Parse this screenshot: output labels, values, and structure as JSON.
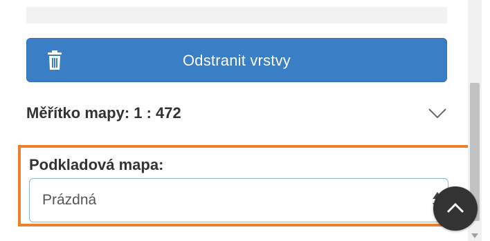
{
  "panel": {
    "delete_layers": {
      "label": "Odstranit vrstvy",
      "icon": "trash-icon"
    },
    "map_scale": {
      "label": "Měřítko mapy: 1 : 472",
      "icon": "chevron-down-icon"
    },
    "base_map": {
      "label": "Podkladová mapa:",
      "selected": "Prázdná",
      "icon": "select-updown-icon"
    }
  },
  "scroll_top_button": {
    "icon": "chevron-up-icon"
  },
  "colors": {
    "button_blue": "#3a7fc5",
    "highlight_orange": "#e8802e",
    "fab_dark": "#333333"
  }
}
